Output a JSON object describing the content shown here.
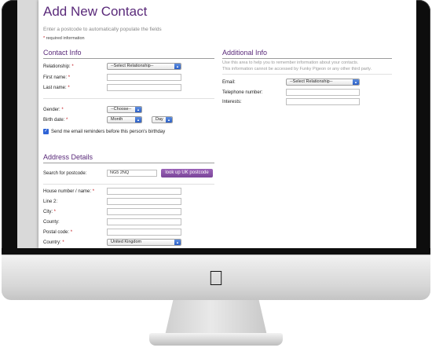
{
  "page": {
    "title": "Add New Contact",
    "hint": "Enter a postcode to automatically populate the fields",
    "required_note": "required information",
    "required_star": "*"
  },
  "contact_info": {
    "heading": "Contact Info",
    "relationship_label": "Relationship:",
    "relationship_value": "--Select Relationship--",
    "first_name_label": "First name:",
    "last_name_label": "Last name:",
    "gender_label": "Gender:",
    "gender_value": "--Choose--",
    "birth_date_label": "Birth date:",
    "month_value": "Month",
    "day_value": "Day",
    "reminder_label": "Send me email reminders before this person's birthday",
    "reminder_checked": true
  },
  "additional_info": {
    "heading": "Additional Info",
    "desc_line1": "Use this area to help you to remember information about your contacts.",
    "desc_line2": "This information cannot be accessed by Funky Pigeon or any other third party.",
    "email_label": "Email:",
    "email_value": "--Select Relationship--",
    "telephone_label": "Telephone number:",
    "interests_label": "Interests:"
  },
  "address": {
    "heading": "Address Details",
    "search_label": "Search for postcode:",
    "search_value": "NG5 2NQ",
    "lookup_button": "look up UK postcode",
    "house_label": "House number / name:",
    "line2_label": "Line 2:",
    "city_label": "City:",
    "county_label": "County:",
    "postal_label": "Postal code:",
    "country_label": "Country:",
    "country_value": "United Kingdom"
  },
  "icons": {
    "apple": "apple-logo-icon",
    "dropdown": "chevron-updown-icon",
    "check": "checkmark-icon"
  }
}
